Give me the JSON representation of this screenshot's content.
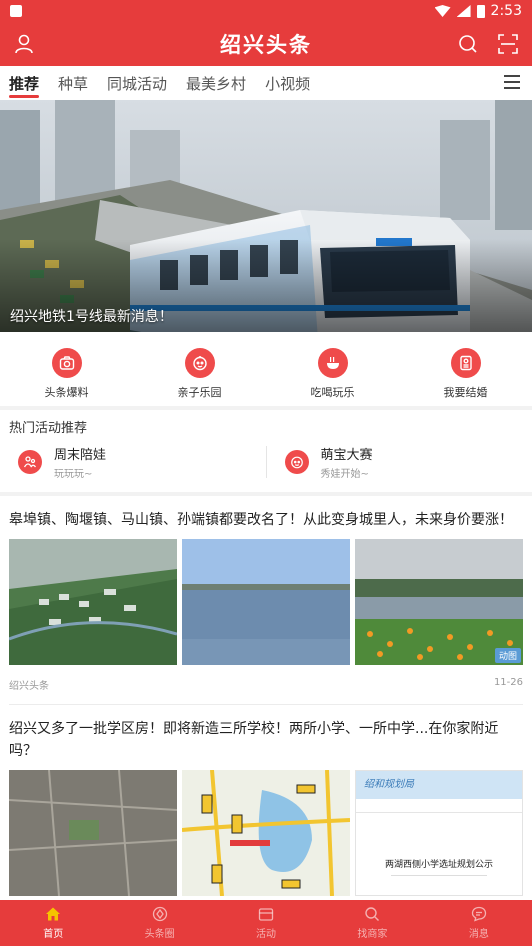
{
  "status": {
    "time": "2:53"
  },
  "app": {
    "title": "绍兴头条",
    "profile_icon": "person-icon",
    "search_icon": "search-icon",
    "scan_icon": "scan-icon"
  },
  "tabs": [
    {
      "label": "推荐",
      "active": true
    },
    {
      "label": "种草",
      "active": false
    },
    {
      "label": "同城活动",
      "active": false
    },
    {
      "label": "最美乡村",
      "active": false
    },
    {
      "label": "小视频",
      "active": false
    }
  ],
  "banner": {
    "caption": "绍兴地铁1号线最新消息！"
  },
  "shortcuts": [
    {
      "label": "头条爆料",
      "icon": "camera-icon"
    },
    {
      "label": "亲子乐园",
      "icon": "baby-face-icon"
    },
    {
      "label": "吃喝玩乐",
      "icon": "bowl-icon"
    },
    {
      "label": "我要结婚",
      "icon": "document-icon"
    }
  ],
  "hot": {
    "title": "热门活动推荐",
    "items": [
      {
        "title": "周末陪娃",
        "subtitle": "玩玩玩~",
        "icon": "family-icon"
      },
      {
        "title": "萌宝大赛",
        "subtitle": "秀娃开始~",
        "icon": "baby-face-icon"
      }
    ]
  },
  "articles": [
    {
      "headline": "皋埠镇、陶堰镇、马山镇、孙端镇都要改名了！从此变身城里人，未来身价要涨！",
      "source": "绍兴头条",
      "date": "11-26",
      "badge": "动图"
    },
    {
      "headline": "绍兴又多了一批学区房！即将新造三所学校！两所小学、一所中学...在你家附近吗？",
      "doc_header": "绍和规划局",
      "doc_title": "两湖西侧小学选址规划公示"
    }
  ],
  "nav": [
    {
      "label": "首页",
      "active": true
    },
    {
      "label": "头条圈",
      "active": false
    },
    {
      "label": "活动",
      "active": false
    },
    {
      "label": "找商家",
      "active": false
    },
    {
      "label": "消息",
      "active": false
    }
  ],
  "colors": {
    "brand": "#e63c3c",
    "accent": "#ef4b4b"
  }
}
